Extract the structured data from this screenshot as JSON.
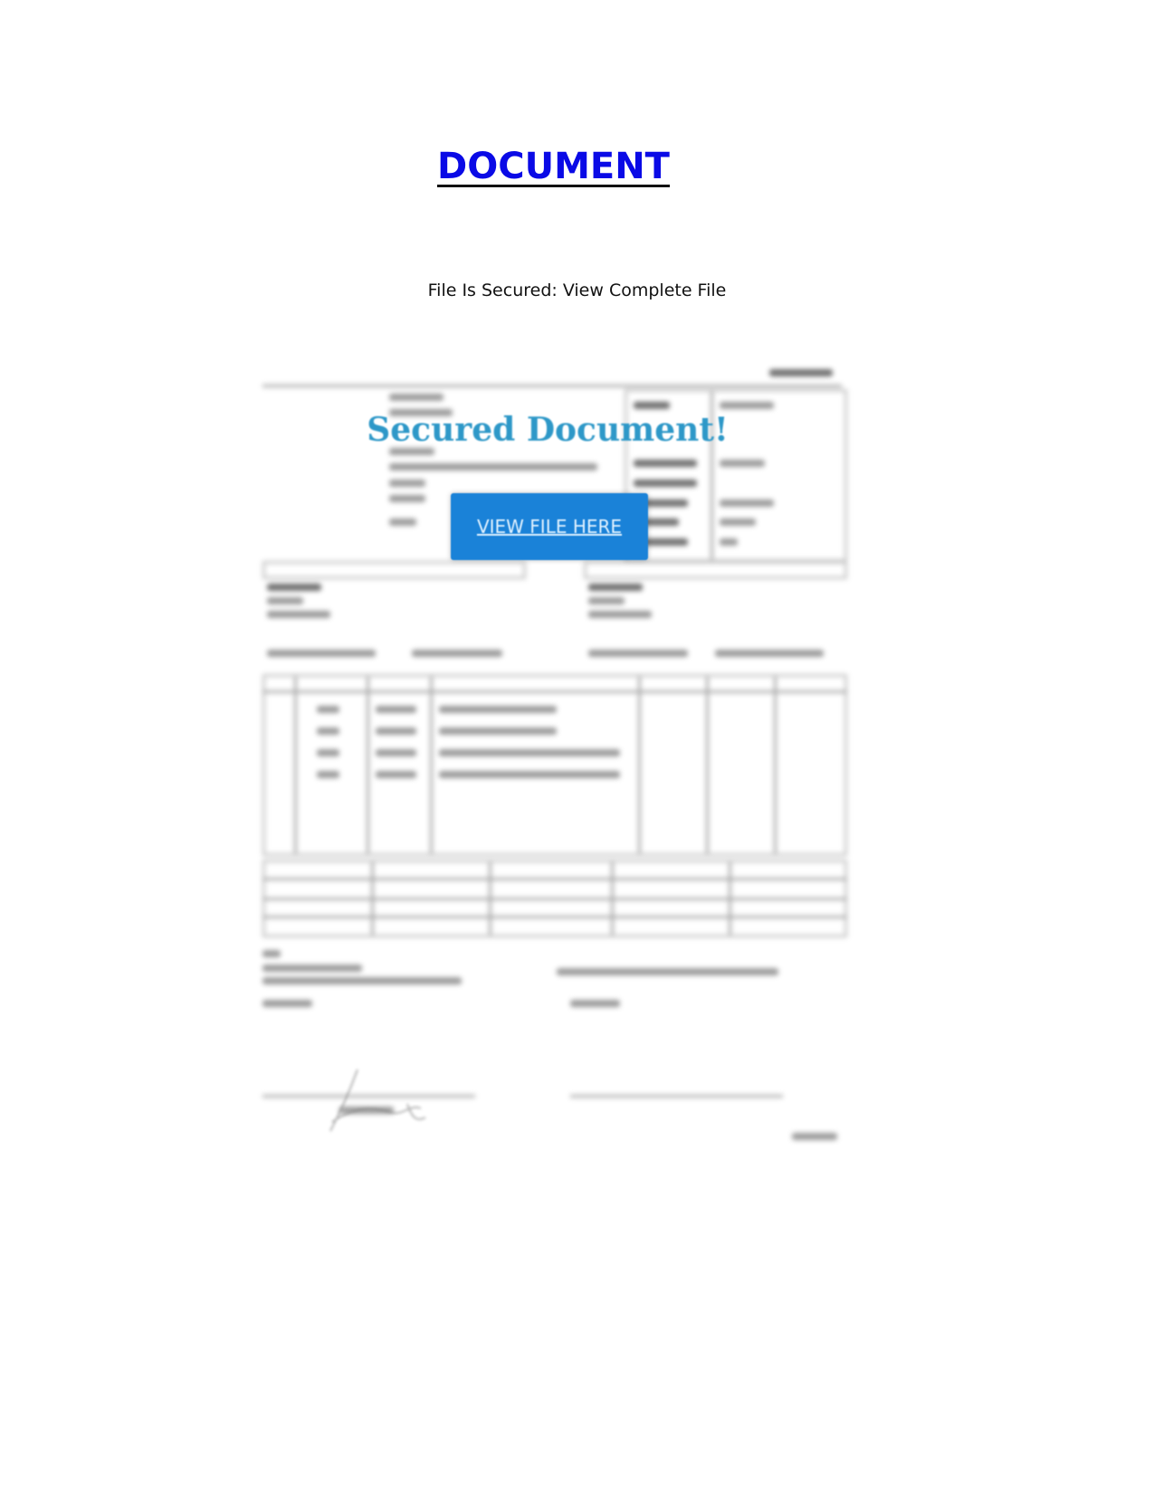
{
  "header": {
    "title": "DOCUMENT",
    "subtitle": "File Is Secured: View Complete File"
  },
  "overlay": {
    "heading": "Secured Document!",
    "button_label": "VIEW FILE HERE"
  },
  "colors": {
    "title": "#0a0ae6",
    "overlay_heading": "#2e98c8",
    "button_bg": "#1a82d8"
  }
}
